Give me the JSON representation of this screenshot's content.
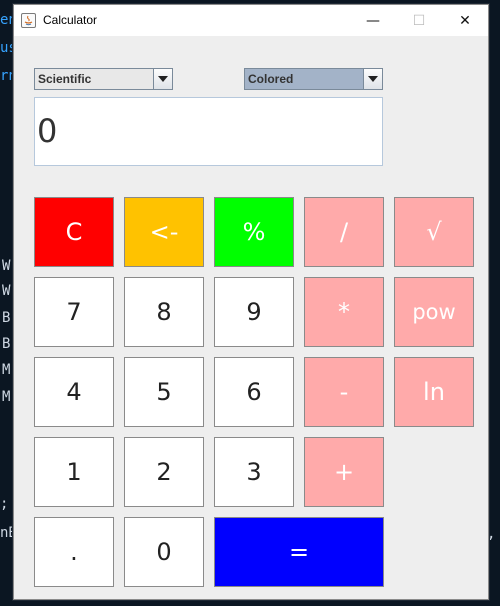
{
  "window": {
    "title": "Calculator",
    "minimize_glyph": "—",
    "maximize_glyph": "☐",
    "close_glyph": "✕"
  },
  "background_fragments": [
    {
      "text": "en"
    },
    {
      "text": "us"
    },
    {
      "text": "rn"
    },
    {
      "text": "W"
    },
    {
      "text": "W"
    },
    {
      "text": "B"
    },
    {
      "text": "B"
    },
    {
      "text": "M"
    },
    {
      "text": "M"
    },
    {
      "text": ";"
    },
    {
      "text": "nB"
    },
    {
      "text": ","
    }
  ],
  "controls": {
    "mode_select": "Scientific",
    "theme_select": "Colored"
  },
  "display": {
    "value": "0"
  },
  "keys": {
    "clear": "C",
    "backspace": "<-",
    "percent": "%",
    "divide": "/",
    "sqrt": "√",
    "seven": "7",
    "eight": "8",
    "nine": "9",
    "multiply": "*",
    "pow": "pow",
    "four": "4",
    "five": "5",
    "six": "6",
    "minus": "-",
    "ln": "ln",
    "one": "1",
    "two": "2",
    "three": "3",
    "plus": "+",
    "dot": ".",
    "zero": "0",
    "equals": "="
  },
  "colors": {
    "clear": "#ff0000",
    "backspace": "#ffc200",
    "percent": "#00ff00",
    "operator": "#ffaaaa",
    "equals": "#0000ff",
    "digit": "#ffffff",
    "window_bg": "#eeeeee"
  }
}
